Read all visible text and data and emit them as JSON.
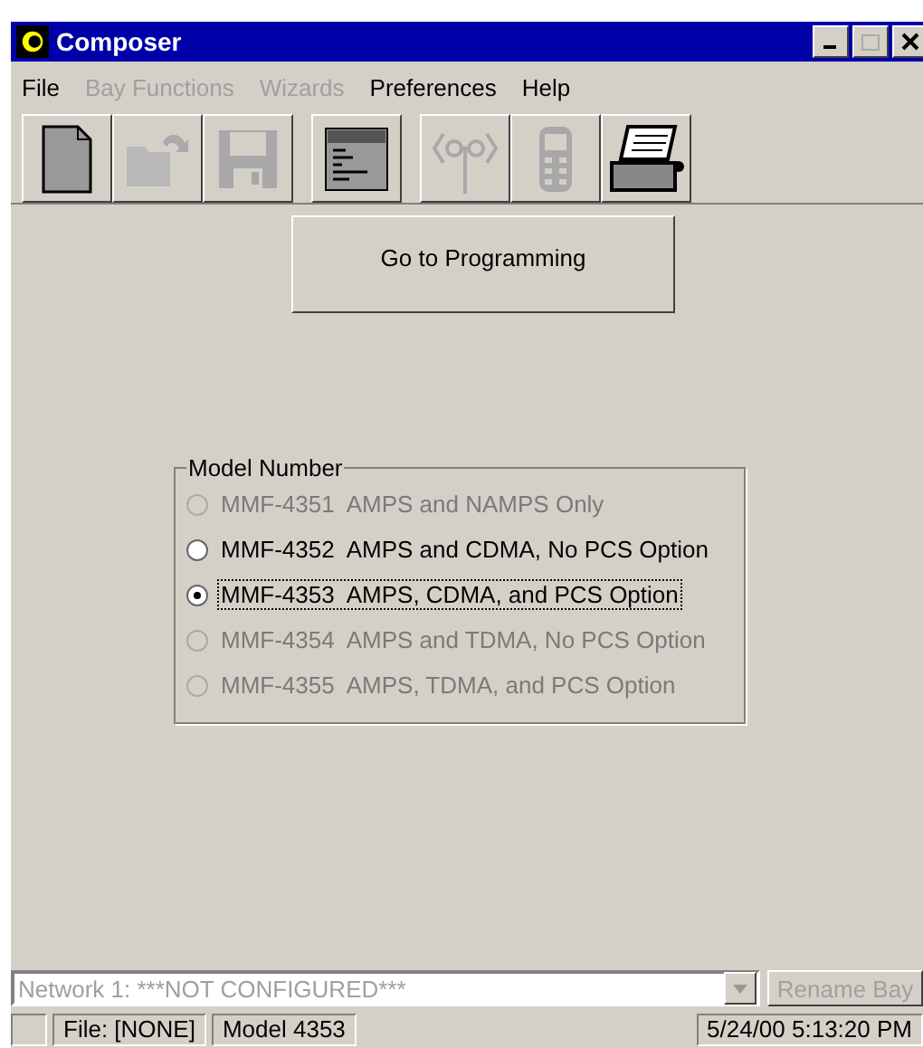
{
  "window": {
    "title": "Composer"
  },
  "menu": [
    {
      "label": "File",
      "disabled": false
    },
    {
      "label": "Bay Functions",
      "disabled": true
    },
    {
      "label": "Wizards",
      "disabled": true
    },
    {
      "label": "Preferences",
      "disabled": false
    },
    {
      "label": "Help",
      "disabled": false
    }
  ],
  "toolbar": [
    {
      "kind": "new",
      "disabled": false
    },
    {
      "kind": "open",
      "disabled": true
    },
    {
      "kind": "save",
      "disabled": true
    },
    {
      "kind": "report",
      "disabled": false
    },
    {
      "kind": "antenna",
      "disabled": true
    },
    {
      "kind": "phone",
      "disabled": true
    },
    {
      "kind": "printer",
      "disabled": false
    }
  ],
  "go_button": "Go to Programming",
  "model_group": {
    "title": "Model Number",
    "options": [
      {
        "label": "MMF-4351  AMPS and NAMPS Only",
        "disabled": true,
        "selected": false
      },
      {
        "label": "MMF-4352  AMPS and CDMA, No PCS Option",
        "disabled": false,
        "selected": false
      },
      {
        "label": "MMF-4353  AMPS, CDMA, and PCS Option",
        "disabled": false,
        "selected": true
      },
      {
        "label": "MMF-4354  AMPS and TDMA, No PCS Option",
        "disabled": true,
        "selected": false
      },
      {
        "label": "MMF-4355  AMPS, TDMA, and PCS Option",
        "disabled": true,
        "selected": false
      }
    ]
  },
  "network_select": {
    "value": "Network 1: ***NOT CONFIGURED***",
    "disabled": true
  },
  "rename_button": {
    "label": "Rename Bay",
    "disabled": true
  },
  "status_bar": {
    "file": "File: [NONE]",
    "model": "Model 4353",
    "time": "5/24/00 5:13:20 PM"
  }
}
